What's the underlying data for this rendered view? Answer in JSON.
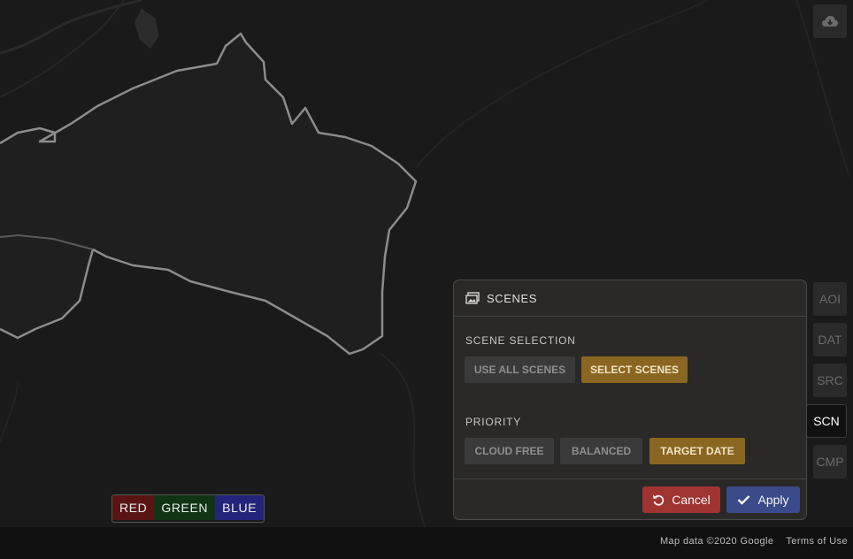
{
  "colors": {
    "map_bg": "#1a1a1a",
    "panel_bg": "#2a2927",
    "selected_accent": "#8a6620",
    "cancel": "#a03431",
    "apply": "#3a4a8a",
    "rgb_red": "#5a1414",
    "rgb_green": "#113414",
    "rgb_blue": "#23247a"
  },
  "toolbar": {
    "download_icon": "cloud-download-icon",
    "items": [
      {
        "label": "AOI",
        "active": false
      },
      {
        "label": "DAT",
        "active": false
      },
      {
        "label": "SRC",
        "active": false
      },
      {
        "label": "SCN",
        "active": true
      },
      {
        "label": "CMP",
        "active": false
      }
    ]
  },
  "panel": {
    "icon": "images-icon",
    "title": "SCENES",
    "scene_selection": {
      "label": "SCENE SELECTION",
      "options": [
        "USE ALL SCENES",
        "SELECT SCENES"
      ],
      "selected": "SELECT SCENES"
    },
    "priority": {
      "label": "PRIORITY",
      "options": [
        "CLOUD FREE",
        "BALANCED",
        "TARGET DATE"
      ],
      "selected": "TARGET DATE"
    },
    "cancel_label": "Cancel",
    "cancel_icon": "undo-icon",
    "apply_label": "Apply",
    "apply_icon": "check-icon"
  },
  "rgb_legend": {
    "red": "RED",
    "green": "GREEN",
    "blue": "BLUE"
  },
  "attribution": {
    "map_data": "Map data ©2020 Google",
    "terms": "Terms of Use"
  }
}
